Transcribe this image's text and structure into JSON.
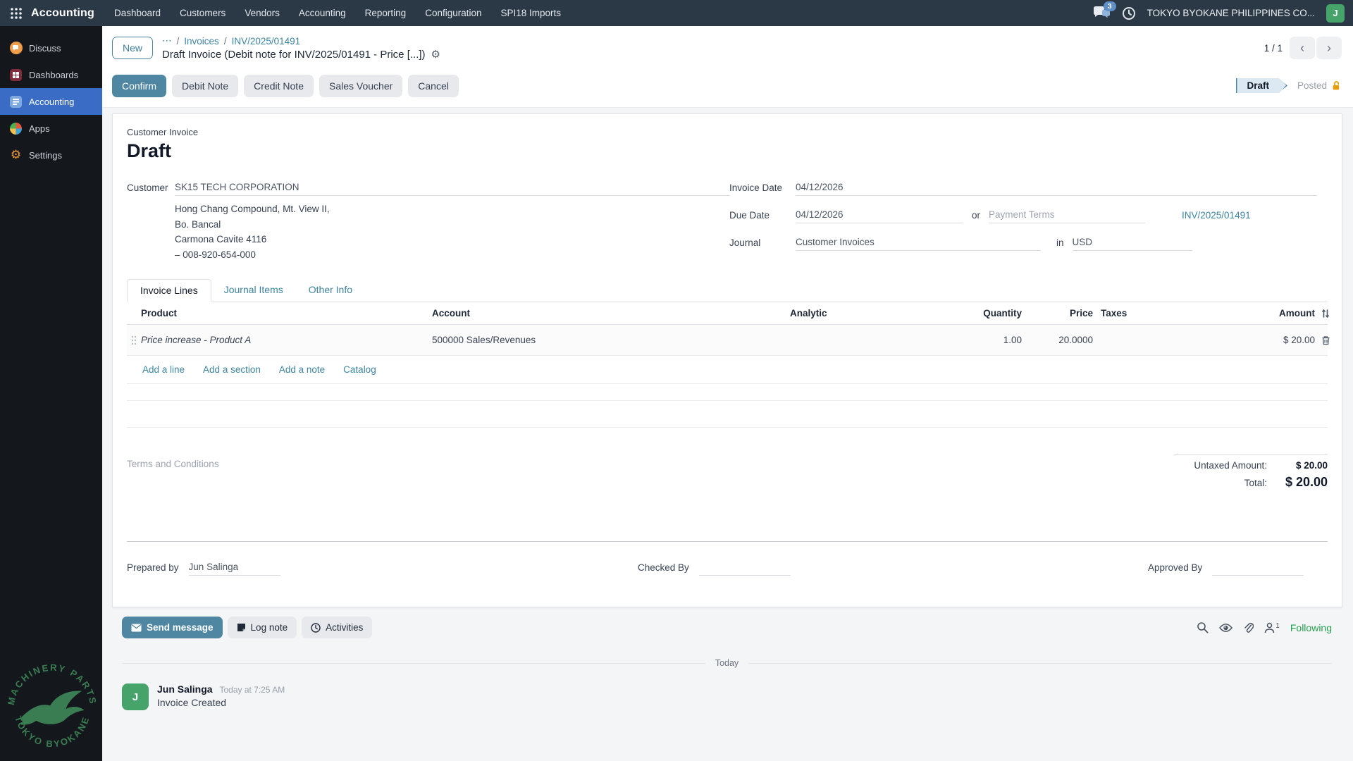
{
  "topbar": {
    "app_name": "Accounting",
    "menus": [
      "Dashboard",
      "Customers",
      "Vendors",
      "Accounting",
      "Reporting",
      "Configuration",
      "SPI18 Imports"
    ],
    "messages_badge": "3",
    "company": "TOKYO BYOKANE PHILIPPINES CO...",
    "user_initial": "J"
  },
  "sidebar": {
    "items": [
      {
        "label": "Discuss"
      },
      {
        "label": "Dashboards"
      },
      {
        "label": "Accounting"
      },
      {
        "label": "Apps"
      },
      {
        "label": "Settings"
      }
    ],
    "watermark_top": "MACHINERY PARTS",
    "watermark_bottom": "TOKYO BYOKANE"
  },
  "control_panel": {
    "new_button": "New",
    "breadcrumb_ellipsis": "⋯",
    "breadcrumb_sep": "/",
    "breadcrumb_invoices": "Invoices",
    "breadcrumb_record": "INV/2025/01491",
    "title": "Draft Invoice (Debit note for INV/2025/01491 - Price [...])",
    "gear_glyph": "⚙",
    "pager": "1 / 1",
    "prev_glyph": "‹",
    "next_glyph": "›"
  },
  "actions": {
    "confirm": "Confirm",
    "debit_note": "Debit Note",
    "credit_note": "Credit Note",
    "sales_voucher": "Sales Voucher",
    "cancel": "Cancel"
  },
  "statusbar": {
    "draft": "Draft",
    "posted": "Posted"
  },
  "form": {
    "doc_type": "Customer Invoice",
    "state_title": "Draft",
    "customer_label": "Customer",
    "customer_name": "SK15 TECH CORPORATION",
    "address": [
      "Hong Chang Compound, Mt. View II,",
      "Bo. Bancal",
      "Carmona Cavite 4116",
      "– 008-920-654-000"
    ],
    "invoice_date_label": "Invoice Date",
    "invoice_date": "04/12/2026",
    "due_date_label": "Due Date",
    "due_date": "04/12/2026",
    "or_label": "or",
    "payment_terms_placeholder": "Payment Terms",
    "reference_link": "INV/2025/01491",
    "journal_label": "Journal",
    "journal": "Customer Invoices",
    "in_label": "in",
    "currency": "USD"
  },
  "tabs": [
    {
      "label": "Invoice Lines"
    },
    {
      "label": "Journal Items"
    },
    {
      "label": "Other Info"
    }
  ],
  "lines_table": {
    "headers": [
      "Product",
      "Account",
      "Analytic",
      "Quantity",
      "Price",
      "Taxes",
      "Amount"
    ],
    "rows": [
      {
        "product": "Price increase - Product A",
        "account": "500000 Sales/Revenues",
        "analytic": "",
        "quantity": "1.00",
        "price": "20.0000",
        "taxes": "",
        "amount": "$ 20.00"
      }
    ],
    "links": [
      "Add a line",
      "Add a section",
      "Add a note",
      "Catalog"
    ]
  },
  "notes_placeholder": "Terms and Conditions",
  "totals": {
    "untaxed_label": "Untaxed Amount:",
    "untaxed": "$ 20.00",
    "total_label": "Total:",
    "total": "$ 20.00"
  },
  "signatures": {
    "prepared_label": "Prepared by",
    "prepared": "Jun Salinga",
    "checked_label": "Checked By",
    "approved_label": "Approved By"
  },
  "chatter": {
    "send_message": "Send message",
    "log_note": "Log note",
    "activities": "Activities",
    "followers_count": "1",
    "following": "Following",
    "divider": "Today",
    "messages": [
      {
        "initial": "J",
        "author": "Jun Salinga",
        "time": "Today at 7:25 AM",
        "body": "Invoice Created"
      }
    ]
  },
  "colors": {
    "topbar_bg": "#2b3947",
    "sidebar_bg": "#14171c",
    "sidebar_active": "#3a6bc5",
    "primary_accent": "#4f87a3",
    "link": "#3d84a0",
    "following_green": "#23a04a",
    "avatar_green": "#46a36a",
    "badge_blue": "#5e8fc9",
    "lock_orange": "#e3a008",
    "watermark_green": "#3a7d52"
  }
}
